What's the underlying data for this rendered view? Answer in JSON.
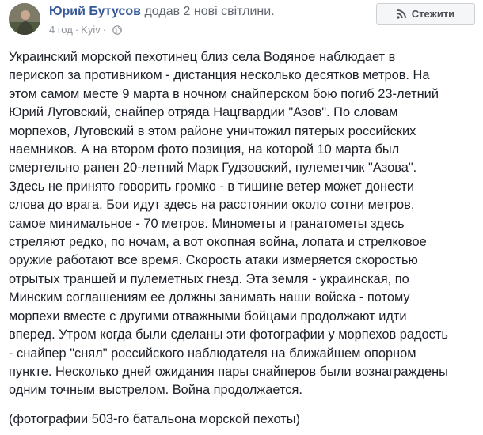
{
  "post": {
    "author": "Юрий Бутусов",
    "action": "додав 2 нові світлини.",
    "time": "4 год",
    "location": "Kyiv",
    "meta_separator": "·",
    "follow_label": "Стежити",
    "icons": {
      "avatar": "avatar-photo",
      "globe": "globe-icon",
      "follow": "rss-icon"
    },
    "text_lines": [
      "Украинский морской пехотинец близ села Водяное наблюдает в",
      "перископ за противником - дистанция несколько десятков метров. На",
      "этом самом месте 9 марта в ночном снайперском бою погиб 23-летний",
      "Юрий Луговский, снайпер отряда Нацгвардии \"Азов\". По словам",
      "морпехов, Луговский в этом районе уничтожил пятерых российских",
      "наемников. А на втором фото позиция, на которой 10 марта был",
      "смертельно ранен 20-летний Марк Гудзовский, пулеметчик \"Азова\".",
      "Здесь не принято говорить громко - в тишине ветер может донести",
      "слова до врага. Бои идут здесь на расстоянии около сотни метров,",
      "самое минимальное - 70 метров. Минометы и гранатометы здесь",
      "стреляют редко, по ночам, а вот окопная война, лопата и стрелковое",
      "оружие работают все время. Скорость атаки измеряется скоростью",
      "отрытых траншей и пулеметных гнезд. Эта земля - украинская, по",
      "Минским соглашениям ее должны занимать наши войска - потому",
      "морпехи вместе с другими отважными бойцами продолжают идти",
      "вперед. Утром когда были сделаны эти фотографии у морпехов радость",
      "- снайпер \"снял\" российского наблюдателя на ближайшем опорном",
      "пункте. Несколько дней ожидания пары снайперов были вознаграждены",
      "одним точным выстрелом. Война продолжается."
    ],
    "caption": "(фотографии 503-го батальона морской пехоты)"
  }
}
